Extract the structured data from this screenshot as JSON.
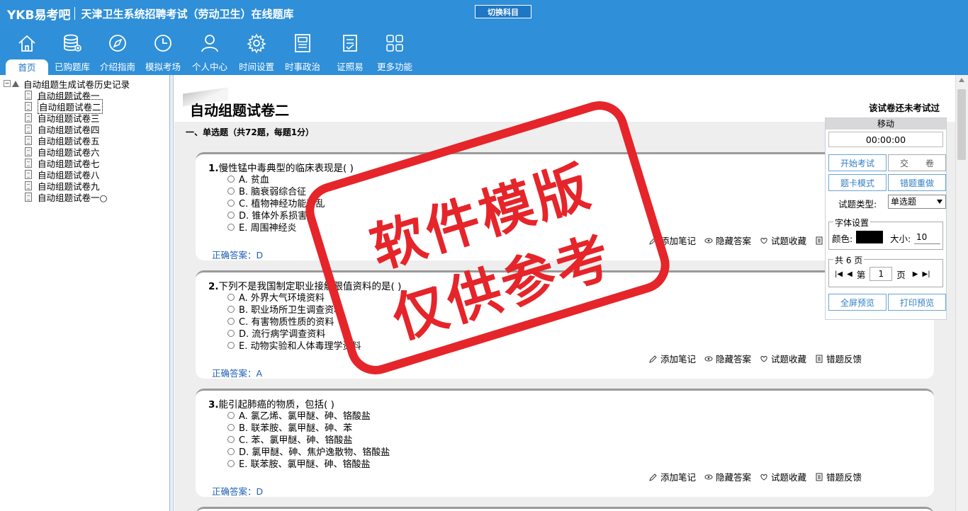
{
  "header": {
    "logo": "YKB易考吧",
    "title": "天津卫生系统招聘考试（劳动卫生）在线题库",
    "switch_label": "切换科目",
    "nav": [
      {
        "label": "首页",
        "icon": "home-icon"
      },
      {
        "label": "已购题库",
        "icon": "database-icon"
      },
      {
        "label": "介绍指南",
        "icon": "compass-icon"
      },
      {
        "label": "模拟考场",
        "icon": "clock-icon"
      },
      {
        "label": "个人中心",
        "icon": "user-icon"
      },
      {
        "label": "时间设置",
        "icon": "gear-icon"
      },
      {
        "label": "时事政治",
        "icon": "newspaper-icon"
      },
      {
        "label": "证照易",
        "icon": "checklist-icon"
      },
      {
        "label": "更多功能",
        "icon": "grid-icon"
      }
    ]
  },
  "tree": {
    "root": "自动组题生成试卷历史记录",
    "items": [
      "自动组题试卷一",
      "自动组题试卷二",
      "自动组题试卷三",
      "自动组题试卷四",
      "自动组题试卷五",
      "自动组题试卷六",
      "自动组题试卷七",
      "自动组题试卷八",
      "自动组题试卷九",
      "自动组题试卷一○"
    ]
  },
  "paper": {
    "title": "自动组题试卷二",
    "status": "该试卷还未考试过",
    "section": "一、单选题（共72题，每题1分）"
  },
  "questions": [
    {
      "num": "1.",
      "stem": "慢性锰中毒典型的临床表现是( )",
      "options": [
        "A. 贫血",
        "B. 脑衰弱综合征",
        "C. 植物神经功能紊乱",
        "D. 锥体外系损害",
        "E. 周围神经炎"
      ],
      "answer_label": "正确答案：",
      "answer": "D"
    },
    {
      "num": "2.",
      "stem": "下列不是我国制定职业接触限值资料的是( )",
      "options": [
        "A. 外界大气环境资料",
        "B. 职业场所卫生调查资料",
        "C. 有害物质性质的资料",
        "D. 流行病学调查资料",
        "E. 动物实验和人体毒理学资料"
      ],
      "answer_label": "正确答案：",
      "answer": "A"
    },
    {
      "num": "3.",
      "stem": "能引起肺癌的物质，包括( )",
      "options": [
        "A. 氯乙烯、氯甲醚、砷、铬酸盐",
        "B. 联苯胺、氯甲醚、砷、苯",
        "C. 苯、氯甲醚、砷、铬酸盐",
        "D. 氯甲醚、砷、焦炉逸散物、铬酸盐",
        "E. 联苯胺、氯甲醚、砷、铬酸盐"
      ],
      "answer_label": "正确答案：",
      "answer": "D"
    }
  ],
  "actions": {
    "add_note": "添加笔记",
    "hide_answer": "隐藏答案",
    "favorite": "试题收藏",
    "feedback": "错题反馈"
  },
  "panel": {
    "move": "移动",
    "timer": "00:00:00",
    "start_exam": "开始考试",
    "submit": "交　　卷",
    "card_mode": "题卡模式",
    "redo_wrong": "错题重做",
    "type_label": "试题类型:",
    "type_value": "单选题",
    "font_legend": "字体设置",
    "color_label": "颜色:",
    "size_label": "大小:",
    "size_value": "10",
    "page_legend": "共 6 页",
    "page_prefix": "第",
    "page_value": "1",
    "page_suffix": "页",
    "fullscreen": "全屏预览",
    "print": "打印预览"
  },
  "stamp": {
    "line1": "软件模版",
    "line2": "仅供参考",
    "color": "#e5252a"
  }
}
